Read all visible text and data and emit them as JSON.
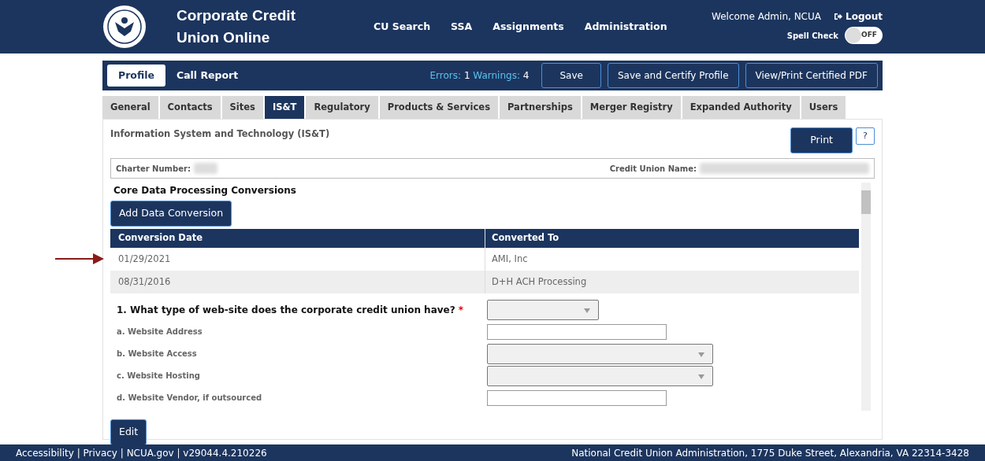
{
  "header": {
    "title": "Corporate Credit Union Online",
    "nav": [
      "CU Search",
      "SSA",
      "Assignments",
      "Administration"
    ],
    "welcome": "Welcome Admin, NCUA",
    "logout": "Logout",
    "spell_check": {
      "label": "Spell Check",
      "on": false,
      "state_text": "OFF"
    }
  },
  "profile_bar": {
    "tabs": [
      {
        "label": "Profile",
        "selected": true
      },
      {
        "label": "Call Report",
        "selected": false
      }
    ],
    "errors_label": "Errors:",
    "errors_count": "1",
    "warnings_label": "Warnings:",
    "warnings_count": "4",
    "buttons": [
      "Save",
      "Save and Certify Profile",
      "View/Print Certified PDF"
    ]
  },
  "tabs": [
    {
      "label": "General",
      "selected": false
    },
    {
      "label": "Contacts",
      "selected": false
    },
    {
      "label": "Sites",
      "selected": false
    },
    {
      "label": "IS&T",
      "selected": true
    },
    {
      "label": "Regulatory",
      "selected": false
    },
    {
      "label": "Products & Services",
      "selected": false
    },
    {
      "label": "Partnerships",
      "selected": false
    },
    {
      "label": "Merger Registry",
      "selected": false
    },
    {
      "label": "Expanded Authority",
      "selected": false
    },
    {
      "label": "Users",
      "selected": false
    }
  ],
  "section": {
    "title": "Information System and Technology (IS&T)",
    "print_button": "Print",
    "help_button": "?"
  },
  "info": {
    "charter_label": "Charter Number:",
    "cu_name_label": "Credit Union Name:"
  },
  "conversions": {
    "title": "Core Data Processing Conversions",
    "add_button": "Add Data Conversion",
    "columns": [
      "Conversion Date",
      "Converted To"
    ],
    "rows": [
      {
        "date": "01/29/2021",
        "converted_to": "AMI, Inc",
        "annotated": true
      },
      {
        "date": "08/31/2016",
        "converted_to": "D+H ACH Processing",
        "annotated": false
      }
    ]
  },
  "questions": [
    {
      "kind": "select",
      "main": true,
      "label": "1. What type of web-site does the corporate credit union have?",
      "required_mark": "*"
    },
    {
      "kind": "text",
      "main": false,
      "label": "a. Website Address"
    },
    {
      "kind": "select",
      "main": false,
      "label": "b. Website Access"
    },
    {
      "kind": "select",
      "main": false,
      "label": "c. Website Hosting"
    },
    {
      "kind": "text",
      "main": false,
      "label": "d. Website Vendor, if outsourced"
    }
  ],
  "edit_button": "Edit",
  "footer": {
    "left": "Accessibility | Privacy | NCUA.gov | v29044.4.210226",
    "right": "National Credit Union Administration, 1775 Duke Street, Alexandria, VA 22314-3428"
  }
}
